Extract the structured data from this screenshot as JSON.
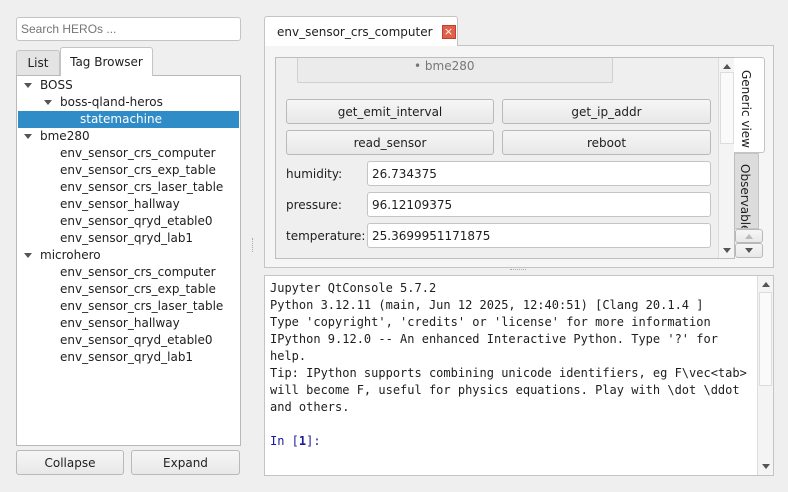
{
  "left": {
    "search_placeholder": "Search HEROs ...",
    "tabs": [
      "List",
      "Tag Browser"
    ],
    "tree": [
      {
        "label": "BOSS",
        "level": 0,
        "expanded": true
      },
      {
        "label": "boss-qland-heros",
        "level": 1,
        "expanded": true
      },
      {
        "label": "statemachine",
        "level": 2,
        "selected": true
      },
      {
        "label": "bme280",
        "level": 0,
        "expanded": true
      },
      {
        "label": "env_sensor_crs_computer",
        "level": 1
      },
      {
        "label": "env_sensor_crs_exp_table",
        "level": 1
      },
      {
        "label": "env_sensor_crs_laser_table",
        "level": 1
      },
      {
        "label": "env_sensor_hallway",
        "level": 1
      },
      {
        "label": "env_sensor_qryd_etable0",
        "level": 1
      },
      {
        "label": "env_sensor_qryd_lab1",
        "level": 1
      },
      {
        "label": "microhero",
        "level": 0,
        "expanded": true
      },
      {
        "label": "env_sensor_crs_computer",
        "level": 1
      },
      {
        "label": "env_sensor_crs_exp_table",
        "level": 1
      },
      {
        "label": "env_sensor_crs_laser_table",
        "level": 1
      },
      {
        "label": "env_sensor_hallway",
        "level": 1
      },
      {
        "label": "env_sensor_qryd_etable0",
        "level": 1
      },
      {
        "label": "env_sensor_qryd_lab1",
        "level": 1
      }
    ],
    "collapse_label": "Collapse",
    "expand_label": "Expand"
  },
  "right": {
    "tab_title": "env_sensor_crs_computer",
    "tag": "bme280",
    "buttons": [
      "get_emit_interval",
      "get_ip_addr",
      "read_sensor",
      "reboot"
    ],
    "fields": [
      {
        "label": "humidity:",
        "value": "26.734375"
      },
      {
        "label": "pressure:",
        "value": "96.12109375"
      },
      {
        "label": "temperature:",
        "value": "25.3699951171875"
      }
    ],
    "side_tabs": [
      "Generic view",
      "Observable"
    ]
  },
  "console": {
    "lines": [
      "Jupyter QtConsole 5.7.2",
      "Python 3.12.11 (main, Jun 12 2025, 12:40:51) [Clang 20.1.4 ]",
      "Type 'copyright', 'credits' or 'license' for more information",
      "IPython 9.12.0 -- An enhanced Interactive Python. Type '?' for",
      "help.",
      "Tip: IPython supports combining unicode identifiers, eg F\\vec<tab>",
      "will become F, useful for physics equations. Play with \\dot \\ddot",
      "and others.",
      ""
    ],
    "prompt_prefix": "In [",
    "prompt_num": "1",
    "prompt_suffix": "]:"
  }
}
